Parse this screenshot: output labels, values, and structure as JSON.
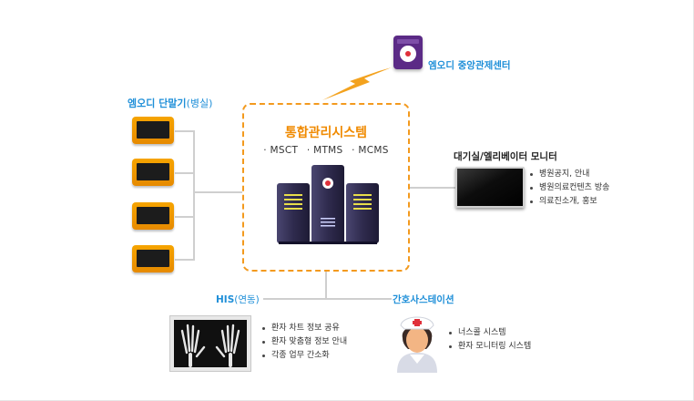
{
  "center_label": "엠오디 중앙관제센터",
  "terminals_label_main": "엠오디 단말기",
  "terminals_label_paren": "(병실)",
  "system": {
    "title": "통합관리시스템",
    "items": [
      "· MSCT",
      "· MTMS",
      "· MCMS"
    ]
  },
  "monitor": {
    "label": "대기실/엘리베이터 모니터",
    "bullets": [
      "병원공지, 안내",
      "병원의료컨텐츠 방송",
      "의료진소개, 홍보"
    ]
  },
  "his": {
    "label_main": "HIS",
    "label_paren": "(연동)",
    "bullets": [
      "환자 차트 정보 공유",
      "환자 맞춤형 정보 안내",
      "각종 업무 간소화"
    ]
  },
  "nurse": {
    "label": "간호사스테이션",
    "bullets": [
      "너스콜 시스템",
      "환자 모니터링 시스템"
    ]
  },
  "colors": {
    "accent_orange": "#f39a1e",
    "label_blue": "#1f8fd8",
    "purple": "#5b2a86",
    "server": "#2e2b4a"
  }
}
